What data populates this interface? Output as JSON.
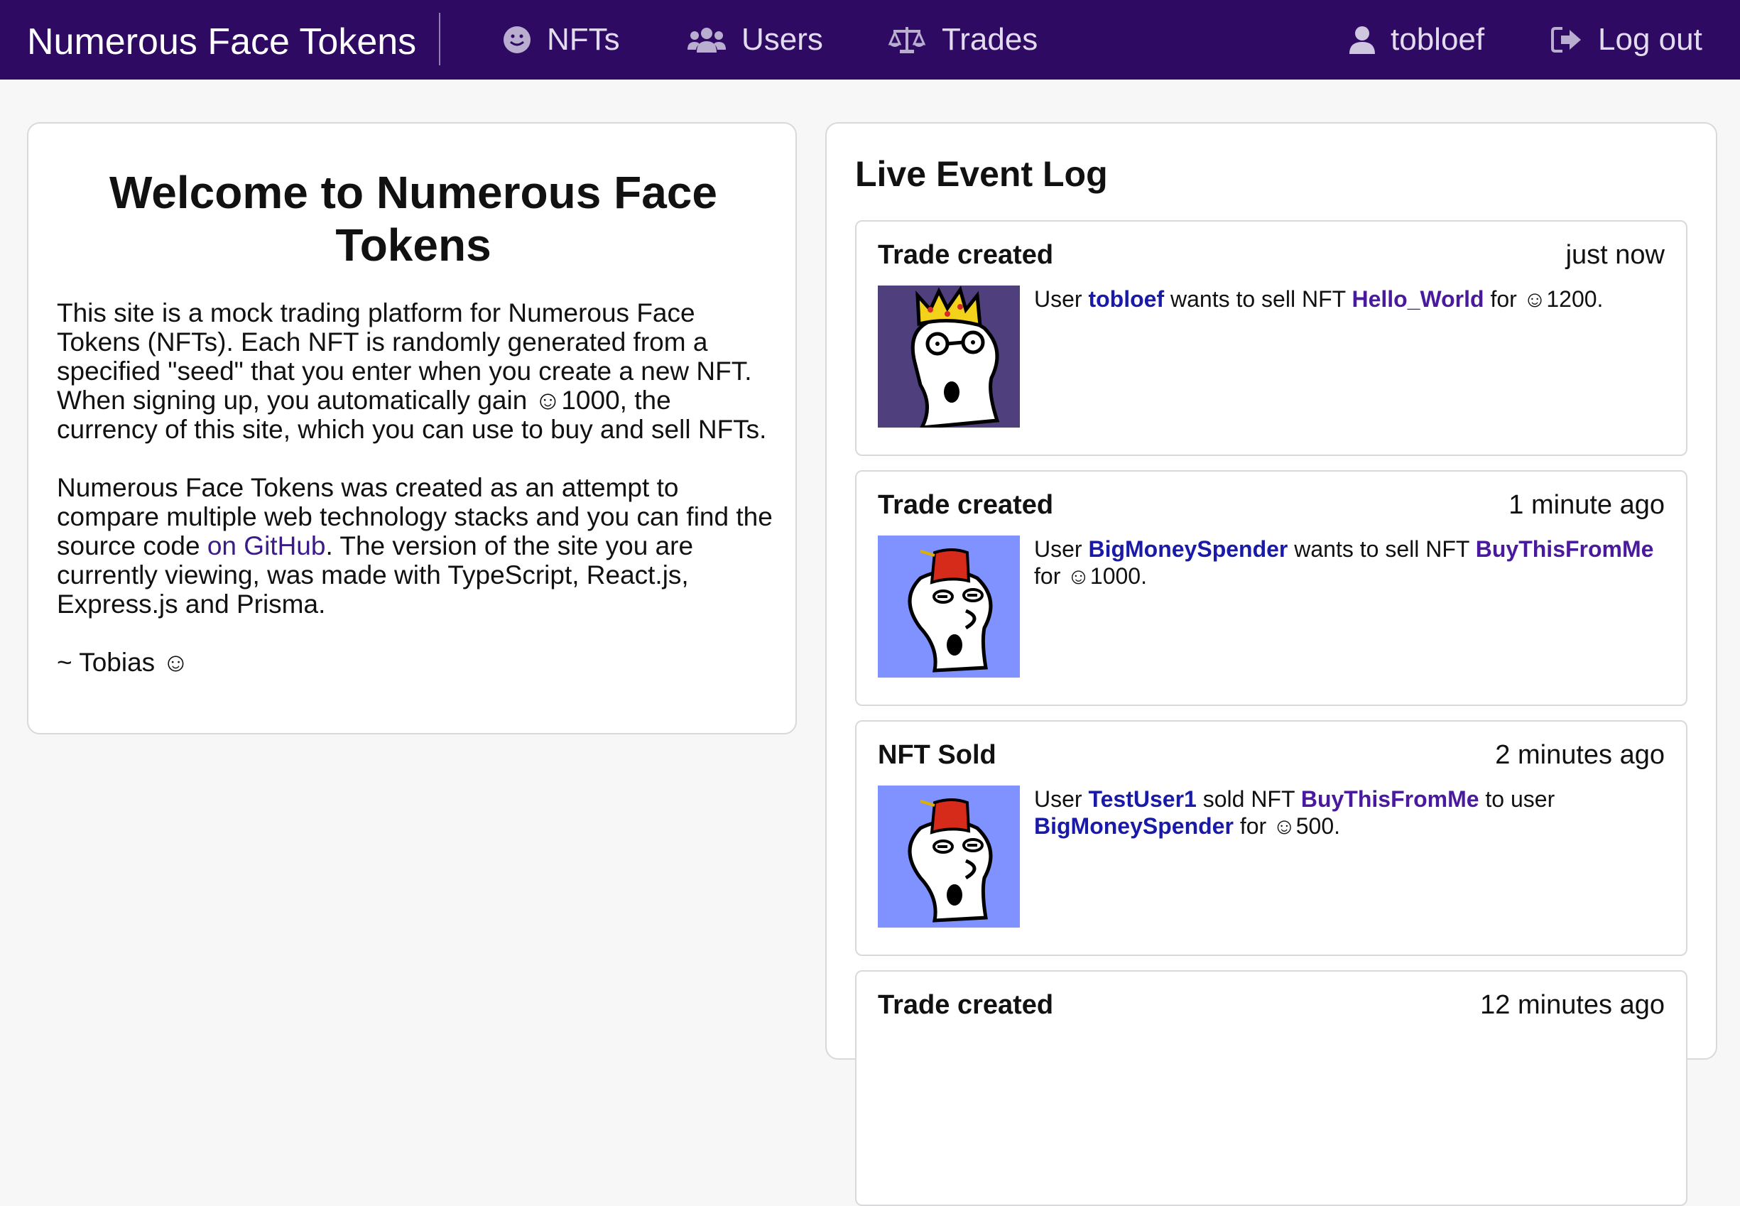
{
  "nav": {
    "brand": "Numerous Face Tokens",
    "nfts": "NFTs",
    "users": "Users",
    "trades": "Trades",
    "username": "tobloef",
    "logout": "Log out"
  },
  "welcome": {
    "title": "Welcome to Numerous Face Tokens",
    "p1": "This site is a mock trading platform for Numerous Face Tokens (NFTs). Each NFT is randomly generated from a specified \"seed\" that you enter when you create a new NFT. When signing up, you automatically gain ☺1000, the currency of this site, which you can use to buy and sell NFTs.",
    "p2_before": "Numerous Face Tokens was created as an attempt to compare multiple web technology stacks and you can find the source code ",
    "p2_link": "on GitHub",
    "p2_after": ". The version of the site you are currently viewing, was made with TypeScript, React.js, Express.js and Prisma.",
    "signature": "~ Tobias ☺"
  },
  "log": {
    "title": "Live Event Log",
    "events": [
      {
        "type": "Trade created",
        "time": "just now",
        "t1": "User ",
        "user": "tobloef",
        "t2": " wants to sell NFT ",
        "nft": "Hello_World",
        "t3": " for ☺1200."
      },
      {
        "type": "Trade created",
        "time": "1 minute ago",
        "t1": "User ",
        "user": "BigMoneySpender",
        "t2": " wants to sell NFT ",
        "nft": "BuyThisFromMe",
        "t3": " for ☺1000."
      },
      {
        "type": "NFT Sold",
        "time": "2 minutes ago",
        "t1": "User ",
        "user": "TestUser1",
        "t2": " sold NFT ",
        "nft": "BuyThisFromMe",
        "t3": " to user ",
        "user2": "BigMoneySpender",
        "t4": " for ☺500."
      },
      {
        "type": "Trade created",
        "time": "12 minutes ago"
      }
    ]
  },
  "colors": {
    "navbar": "#2e0a63",
    "user_link": "#1a1aa8",
    "nft_link": "#4a1a9e",
    "nft_bg_king": "#4f3f7c",
    "nft_bg_fez": "#7f92ff"
  }
}
